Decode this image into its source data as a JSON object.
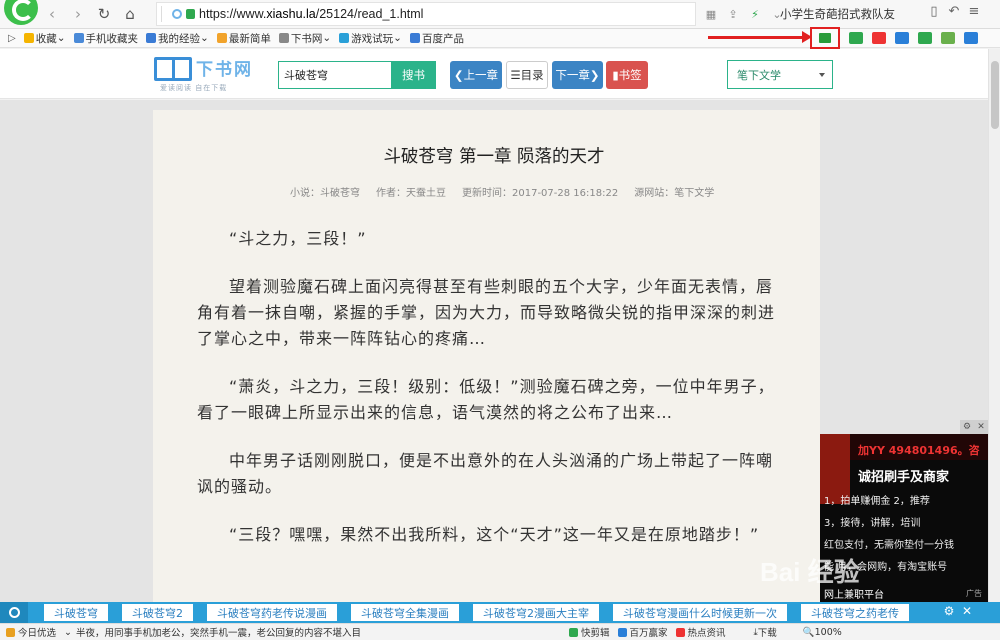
{
  "browser": {
    "url_prefix": "https://www.",
    "url_domain": "xiashu.la",
    "url_path": "/25124/read_1.html",
    "search_hint": "小学生奇葩招式救队友",
    "zoom": "100%"
  },
  "bookmarks": [
    "收藏",
    "手机收藏夹",
    "我的经验",
    "最新简单",
    "下书网",
    "游戏试玩",
    "百度产品"
  ],
  "site": {
    "logo_text": "下书网",
    "logo_tagline": "爱读阅读 自在下载",
    "search_value": "斗破苍穹",
    "search_button": "搜书",
    "prev_button": "上一章",
    "toc_button": "目录",
    "next_button": "下一章",
    "bookmark_button": "书签",
    "source_select": "笔下文学"
  },
  "chapter": {
    "title": "斗破苍穹 第一章 陨落的天才",
    "meta_novel": "小说：斗破苍穹",
    "meta_author": "作者：天蚕土豆",
    "meta_updated": "更新时间：2017-07-28 16:18:22",
    "meta_source": "源网站：笔下文学",
    "paragraphs": [
      "“斗之力，三段！”",
      "望着测验魔石碑上面闪亮得甚至有些刺眼的五个大字，少年面无表情，唇角有着一抹自嘲，紧握的手掌，因为大力，而导致略微尖锐的指甲深深的刺进了掌心之中，带来一阵阵钻心的疼痛…",
      "“萧炎，斗之力，三段！级别：低级！”测验魔石碑之旁，一位中年男子，看了一眼碑上所显示出来的信息，语气漠然的将之公布了出来…",
      "中年男子话刚刚脱口，便是不出意外的在人头汹涌的广场上带起了一阵嘲讽的骚动。",
      "“三段？嘿嘿，果然不出我所料，这个“天才”这一年又是在原地踏步！”"
    ]
  },
  "ad": {
    "line1": "加YY 494801496。咨",
    "line2": "诚招刷手及商家",
    "lines": [
      "1，拍单赚佣金 2，推荐",
      "3，接待，讲解，培训",
      "红包支付，无需你垫付一分钱",
      "能 月，会网购，有淘宝账号"
    ],
    "footer": "网上兼职平台",
    "ad_label": "广告"
  },
  "watermark": "Bai 经验",
  "related": [
    "斗破苍穹",
    "斗破苍穹2",
    "斗破苍穹药老传说漫画",
    "斗破苍穹全集漫画",
    "斗破苍穹2漫画大主宰",
    "斗破苍穹漫画什么时候更新一次",
    "斗破苍穹之药老传"
  ],
  "status": {
    "today": "今日优选",
    "news": "半夜，用同事手机加老公，突然手机一震，老公回复的内容不堪入目",
    "quick": "快剪辑",
    "million": "百万赢家",
    "hot": "热点资讯",
    "download": "下载"
  }
}
